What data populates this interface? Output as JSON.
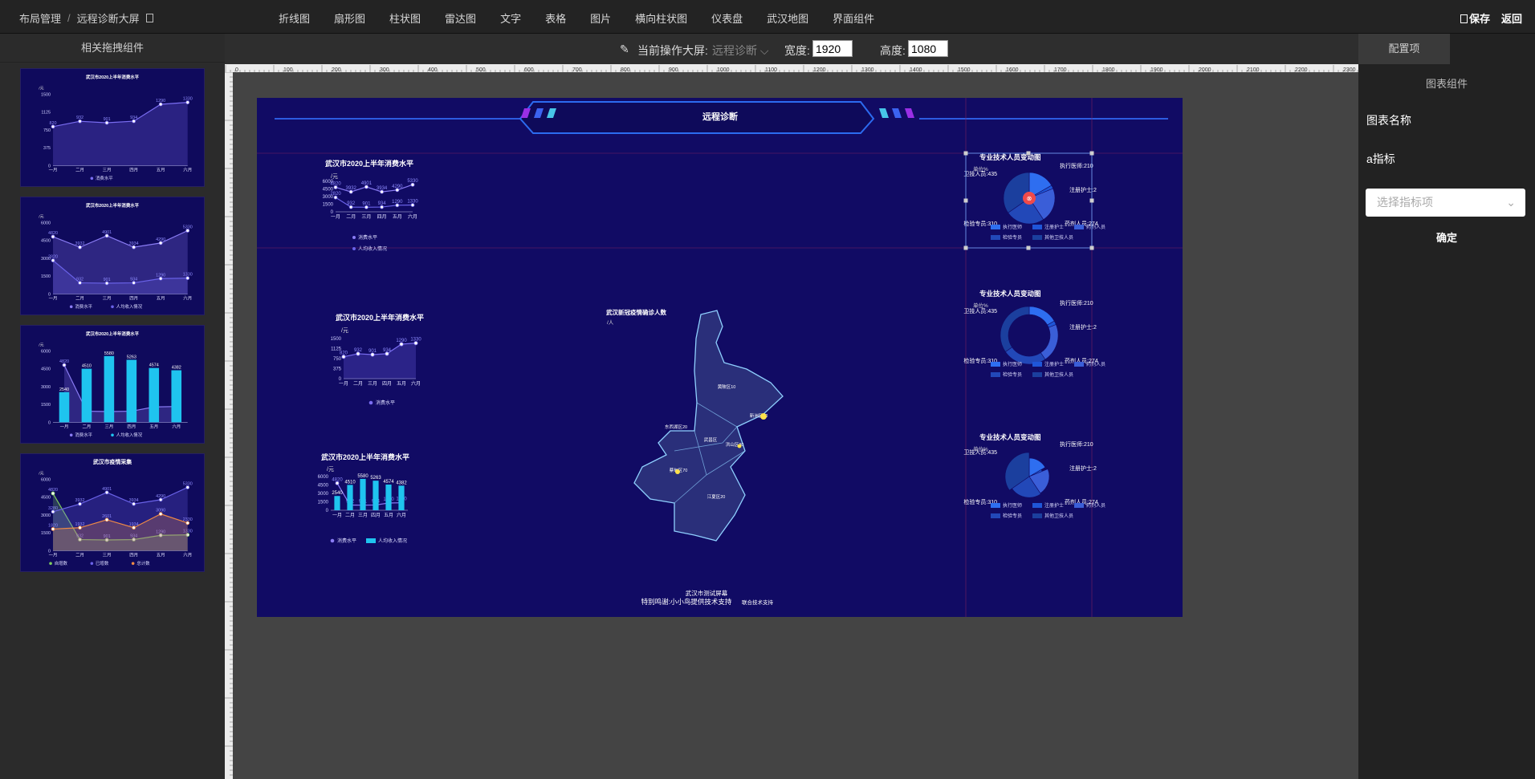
{
  "breadcrumb": {
    "root": "布局管理",
    "separator": "/",
    "current": "远程诊断大屏"
  },
  "top_nav": [
    "折线图",
    "扇形图",
    "柱状图",
    "雷达图",
    "文字",
    "表格",
    "图片",
    "横向柱状图",
    "仪表盘",
    "武汉地图",
    "界面组件"
  ],
  "top_actions": {
    "save": "保存",
    "back": "返回"
  },
  "left_panel": {
    "title": "相关拖拽组件"
  },
  "toolbar": {
    "current_label": "当前操作大屏:",
    "current_value": "远程诊断",
    "width_label": "宽度:",
    "width_value": "1920",
    "height_label": "高度:",
    "height_value": "1080"
  },
  "ruler": {
    "h_ticks": [
      "0",
      "100",
      "200",
      "300",
      "400",
      "500",
      "600",
      "700",
      "800",
      "900",
      "1000",
      "1100",
      "1200",
      "1300",
      "1400",
      "1500",
      "1600",
      "1700",
      "1800",
      "1900",
      "2000",
      "2100",
      "2200",
      "2300"
    ]
  },
  "right_panel": {
    "tab": "配置项",
    "subtitle": "图表组件",
    "chart_name_label": "图表名称",
    "indicator_label": "a指标",
    "select_placeholder": "选择指标项",
    "confirm": "确定"
  },
  "screen": {
    "header_title": "远程诊断",
    "footer_line1": "武汉市测试屏幕",
    "footer_line2": "特别鸣谢:小小鸟提供技术支持",
    "footer_line2_suffix": "联合技术支持",
    "map_title": "武汉新冠疫情确诊人数",
    "map_unit": "/人",
    "map_districts": [
      "黄陂区10",
      "新洲区20",
      "东西湖区20",
      "蔡甸区70",
      "江夏区20",
      "武昌区",
      "洪山区30"
    ],
    "charts": {
      "line1_title": "武汉市2020上半年消费水平",
      "line2_title": "武汉市2020上半年消费水平",
      "bar_title": "武汉市2020上半年消费水平",
      "pie_titles": [
        "专业技术人员变动图",
        "专业技术人员变动图",
        "专业技术人员变动图"
      ],
      "unit_yuan": "/元",
      "unit_yi": "单位%",
      "legend_consume": "消费水平",
      "legend_income": "人均收入情况",
      "pie_labels": [
        "执行医师:210",
        "注册护士:2",
        "药剂人员:274",
        "检验专员:310",
        "卫技人员:435"
      ],
      "pie_legend": [
        "执行医师",
        "注册护士",
        "药剂人员",
        "检验专员",
        "其他卫技人员"
      ]
    }
  },
  "thumbnails": [
    {
      "title": "武汉市2020上半年消费水平",
      "legend": [
        "消费水平"
      ]
    },
    {
      "title": "武汉市2020上半年消费水平",
      "legend": [
        "消费水平",
        "人均收入情况"
      ]
    },
    {
      "title": "武汉市2020上半年消费水平",
      "legend": [
        "消费水平",
        "人均收入情况"
      ]
    },
    {
      "title": "武汉市疫情采集",
      "legend": [
        "自增数",
        "已增数",
        "总计数"
      ]
    }
  ],
  "chart_data": [
    {
      "type": "line",
      "title": "武汉市2020上半年消费水平",
      "categories": [
        "一月",
        "二月",
        "三月",
        "四月",
        "五月",
        "六月"
      ],
      "series": [
        {
          "name": "消费水平",
          "values": [
            820,
            932,
            901,
            934,
            1290,
            1330
          ]
        }
      ],
      "ylabel": "/元",
      "ylim": [
        0,
        1500
      ]
    },
    {
      "type": "line",
      "title": "武汉市2020上半年消费水平",
      "categories": [
        "一月",
        "二月",
        "三月",
        "四月",
        "五月",
        "六月"
      ],
      "series": [
        {
          "name": "消费水平",
          "values": [
            4820,
            3932,
            4901,
            3934,
            4290,
            5330
          ]
        },
        {
          "name": "人均收入情况",
          "values": [
            2820,
            932,
            901,
            934,
            1290,
            1330
          ]
        }
      ],
      "ylabel": "/元",
      "ylim": [
        0,
        6000
      ]
    },
    {
      "type": "bar",
      "title": "武汉市2020上半年消费水平",
      "categories": [
        "一月",
        "二月",
        "三月",
        "四月",
        "五月",
        "六月"
      ],
      "series": [
        {
          "name": "消费水平",
          "values": [
            4820,
            932,
            901,
            934,
            1290,
            1330
          ]
        },
        {
          "name": "人均收入情况",
          "values": [
            2540,
            4510,
            5580,
            5263,
            4574,
            4382
          ]
        }
      ],
      "ylabel": "/元",
      "ylim": [
        0,
        6000
      ]
    },
    {
      "type": "line",
      "title": "武汉市疫情采集",
      "categories": [
        "一月",
        "二月",
        "三月",
        "四月",
        "五月",
        "六月"
      ],
      "series": [
        {
          "name": "自增数",
          "values": [
            4820,
            932,
            901,
            934,
            1290,
            1330
          ]
        },
        {
          "name": "已增数",
          "values": [
            3280,
            3932,
            4901,
            3934,
            4290,
            5330
          ]
        },
        {
          "name": "总计数",
          "values": [
            1820,
            1932,
            2601,
            1934,
            3090,
            2330
          ]
        }
      ],
      "ylabel": "/元",
      "ylim": [
        0,
        6000
      ]
    },
    {
      "type": "pie",
      "title": "专业技术人员变动图",
      "categories": [
        "执行医师",
        "注册护士",
        "药剂人员",
        "检验专员",
        "卫技人员"
      ],
      "values": [
        210,
        27,
        274,
        310,
        435
      ]
    }
  ]
}
